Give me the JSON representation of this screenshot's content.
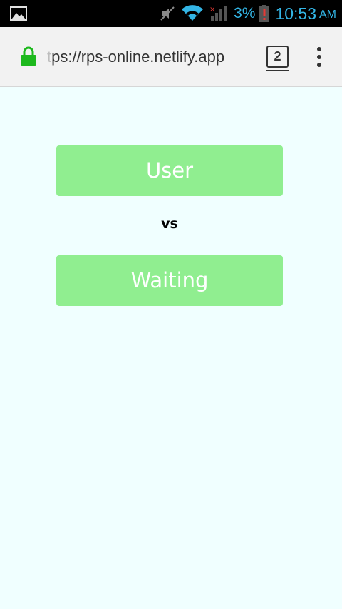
{
  "status_bar": {
    "battery_percent": "3%",
    "time": "10:53",
    "ampm": "AM",
    "icons": [
      "image-icon",
      "mute-icon",
      "wifi-icon",
      "signal-icon",
      "battery-icon"
    ],
    "accent_color": "#33b5e5"
  },
  "browser": {
    "url_faded": "t",
    "url": "ps://rps-online.netlify.app",
    "tab_count": "2",
    "icons": [
      "lock-icon",
      "overflow-menu-icon"
    ],
    "lock_color": "#1db91d"
  },
  "page": {
    "player_one": "User",
    "versus": "vs",
    "player_two": "Waiting",
    "button_color": "#90ee90",
    "background_color": "#f0ffff"
  }
}
